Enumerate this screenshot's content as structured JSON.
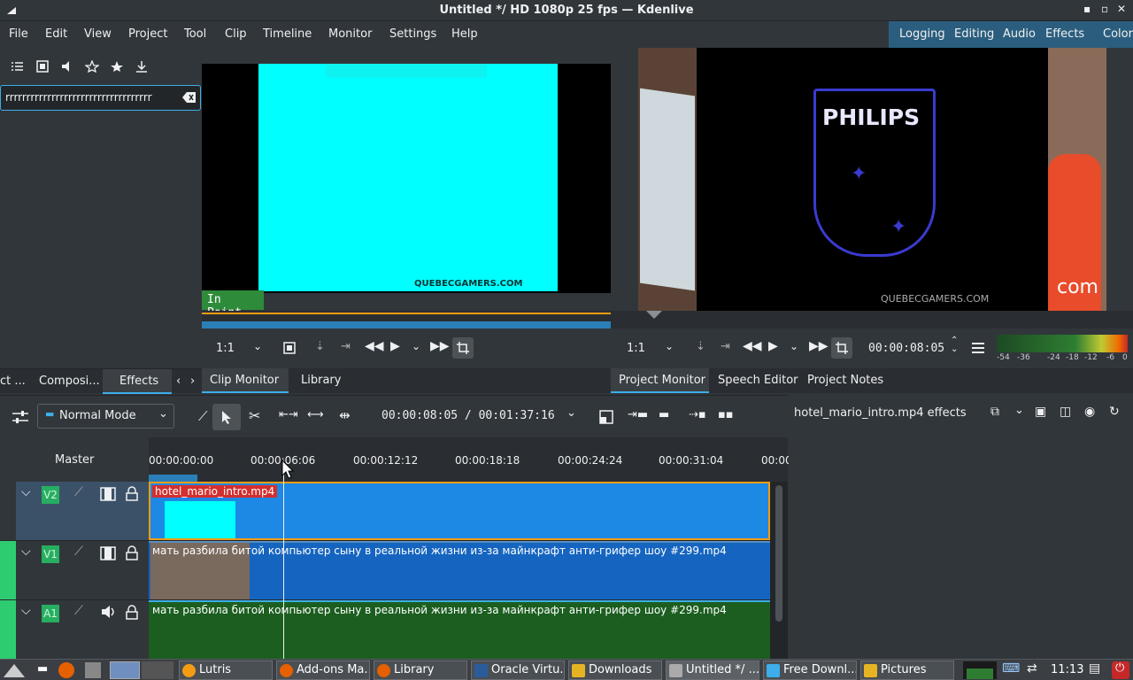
{
  "window": {
    "title": "Untitled */ HD 1080p 25 fps — Kdenlive"
  },
  "menu": [
    "File",
    "Edit",
    "View",
    "Project",
    "Tool",
    "Clip",
    "Timeline",
    "Monitor",
    "Settings",
    "Help"
  ],
  "layouts": [
    "Logging",
    "Editing",
    "Audio",
    "Effects",
    "Color"
  ],
  "left_panel": {
    "search_value": "rrrrrrrrrrrrrrrrrrrrrrrrrrrrrrrrrrr",
    "tabs": [
      "ct ...",
      "Composi...",
      "Effects"
    ]
  },
  "clip_monitor": {
    "in_point_label": "In Point",
    "watermark": "QUEBECGAMERS.COM",
    "zoom": "1:1",
    "tabs": [
      "Clip Monitor",
      "Library"
    ]
  },
  "project_monitor": {
    "logo_text": "PHILIPS",
    "watermark": "QUEBECGAMERS.COM",
    "side_text": "com",
    "zoom": "1:1",
    "timecode": "00:00:08:05",
    "tabs": [
      "Project Monitor",
      "Speech Editor",
      "Project Notes"
    ]
  },
  "audio_meter": {
    "scale": [
      "-54",
      "-36",
      "-24",
      "-18",
      "-12",
      "-6",
      "0"
    ]
  },
  "timeline": {
    "mode": "Normal Mode",
    "timecode": "00:00:08:05 / 00:01:37:16",
    "master_label": "Master",
    "ruler": [
      "00:00:00:00",
      "00:00:06:06",
      "00:00:12:12",
      "00:00:18:18",
      "00:00:24:24",
      "00:00:31:04",
      "00:00"
    ],
    "tracks": [
      {
        "name": "V2",
        "clip": "hotel_mario_intro.mp4"
      },
      {
        "name": "V1",
        "clip": "мать разбила битой компьютер сыну в реальной жизни из-за майнкрафт анти-грифер шоу #299.mp4"
      },
      {
        "name": "A1",
        "clip": "мать разбила битой компьютер сыну в реальной жизни из-за майнкрафт анти-грифер шоу #299.mp4"
      }
    ]
  },
  "effects_panel": {
    "title": "hotel_mario_intro.mp4 effects"
  },
  "taskbar": {
    "items": [
      "Lutris",
      "Add-ons Ma...",
      "Library",
      "Oracle Virtu...",
      "Downloads",
      "Untitled */ ...",
      "Free Downl...",
      "Pictures"
    ],
    "clock": "11:13"
  },
  "colors": {
    "accent": "#3daee9",
    "track_green": "#27ae60",
    "clip_blue": "#1e88e5",
    "cyan": "#00ffff"
  }
}
